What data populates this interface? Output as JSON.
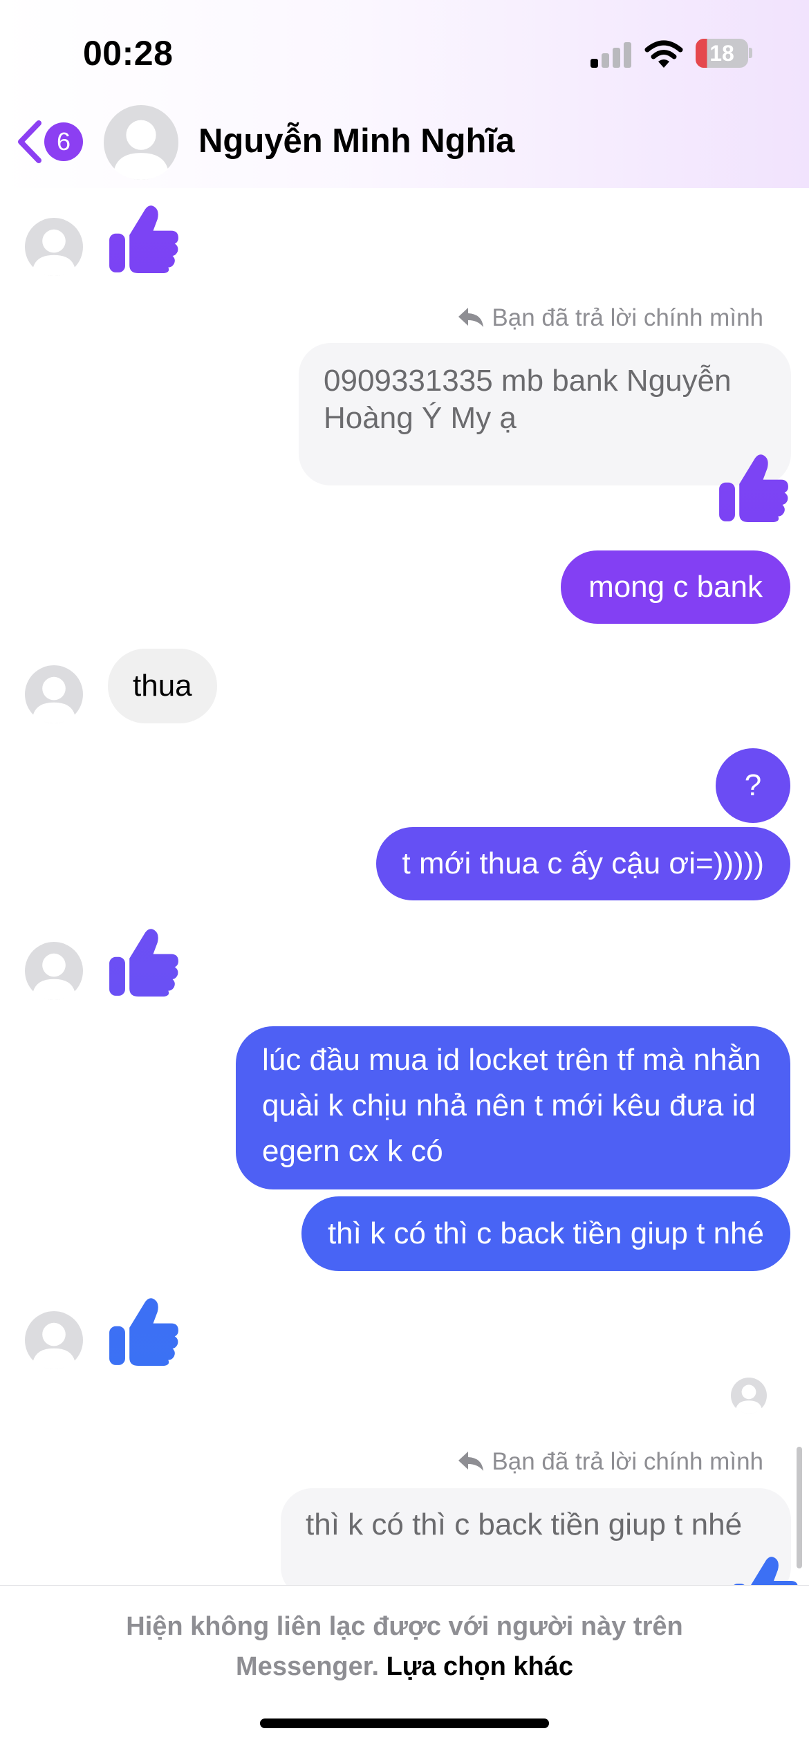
{
  "status_bar": {
    "time": "00:28",
    "battery_level": "18"
  },
  "header": {
    "unread_count": "6",
    "contact_name": "Nguyễn Minh Nghĩa"
  },
  "colors": {
    "accent_purple": "#8c3ff2",
    "gradient_start": "#8e3ff2",
    "gradient_end": "#3f6ef5",
    "incoming_bubble": "#f0f0f0"
  },
  "messages": {
    "reply_label_1": "Bạn đã trả lời chính mình",
    "quoted_1": "0909331335 mb bank Nguyễn Hoàng Ý My ạ",
    "out_1": "mong c bank",
    "in_1": "thua",
    "out_2": "?",
    "out_3": "t mới thua c ấy cậu ơi=)))))",
    "out_4": "lúc đầu mua id locket trên tf mà nhằn quài k chịu nhả nên t mới kêu đưa id egern cx k có",
    "out_5": "thì k có thì c back tiền giup t nhé",
    "reply_label_2": "Bạn đã trả lời chính mình",
    "quoted_2": "thì k có thì c back tiền giup t nhé"
  },
  "footer": {
    "notice": "Hiện không liên lạc được với người này trên Messenger.",
    "link": "Lựa chọn khác"
  }
}
